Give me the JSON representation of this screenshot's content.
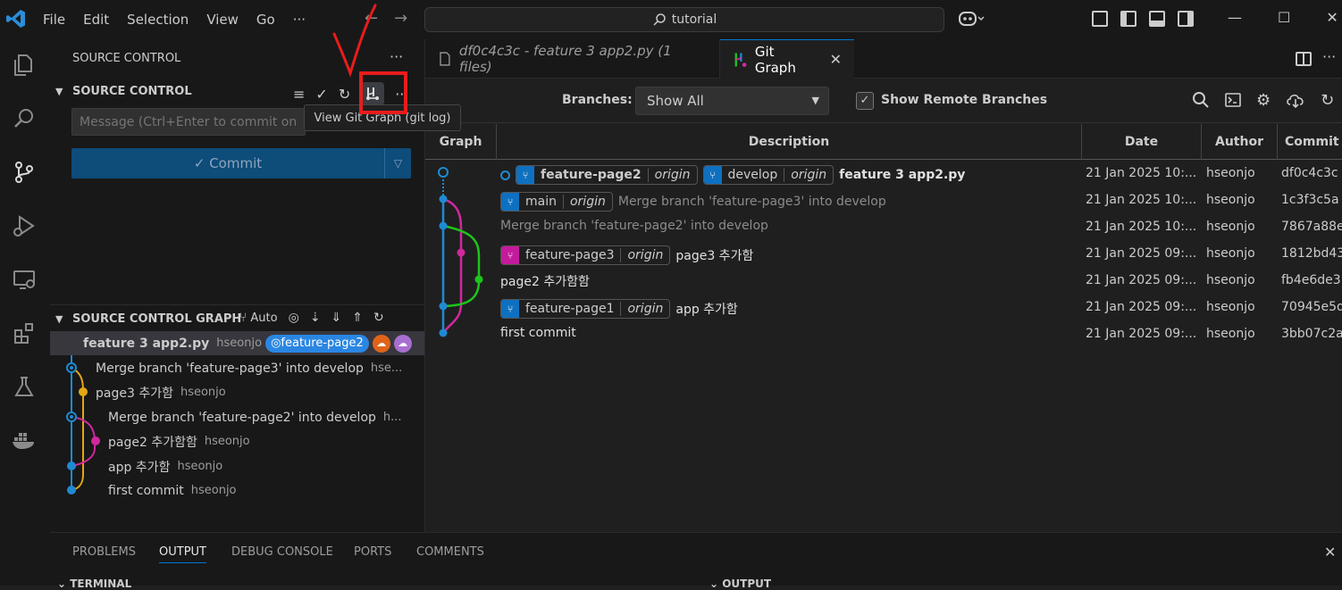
{
  "menu": [
    "File",
    "Edit",
    "Selection",
    "View",
    "Go",
    "···"
  ],
  "nav": {
    "back": "←",
    "forward": "→"
  },
  "search": {
    "text": "tutorial"
  },
  "window": {
    "minimize": "—",
    "maximize": "☐",
    "close": "✕"
  },
  "sidebar": {
    "title": "SOURCE CONTROL",
    "more": "···",
    "section_title": "SOURCE CONTROL",
    "message_placeholder": "Message (Ctrl+Enter to commit on",
    "commit_label": "✓ Commit",
    "tooltip": "View Git Graph (git log)",
    "graph_section_title": "SOURCE CONTROL GRAPH",
    "graph_auto": "Auto",
    "graph_commits": [
      {
        "message": "feature 3 app2.py",
        "author": "hseonjo",
        "badge": "feature-page2"
      },
      {
        "message": "Merge branch 'feature-page3' into develop",
        "author": "hse..."
      },
      {
        "message": "page3 추가함",
        "author": "hseonjo"
      },
      {
        "message": "Merge branch 'feature-page2' into develop",
        "author": "h..."
      },
      {
        "message": "page2 추가함함",
        "author": "hseonjo"
      },
      {
        "message": "app 추가함",
        "author": "hseonjo"
      },
      {
        "message": "first commit",
        "author": "hseonjo"
      }
    ]
  },
  "tabs": [
    {
      "label": "df0c4c3c - feature 3 app2.py (1 files)"
    },
    {
      "label": "Git Graph",
      "close": "✕"
    }
  ],
  "gitgraph": {
    "branches_label": "Branches:",
    "branches_value": "Show All",
    "remote_checked": "✓",
    "remote_label": "Show Remote Branches",
    "columns": [
      "Graph",
      "Description",
      "Date",
      "Author",
      "Commit"
    ],
    "rows": [
      {
        "refs": [
          {
            "name": "feature-page2",
            "color": "#0e70c0",
            "origin": "origin",
            "bold": true
          },
          {
            "name": "develop",
            "color": "#0e70c0",
            "origin": "origin"
          }
        ],
        "message": "feature 3 app2.py",
        "muted": false,
        "bold": true,
        "date": "21 Jan 2025 10:...",
        "author": "hseonjo",
        "hash": "df0c4c3c"
      },
      {
        "refs": [
          {
            "name": "main",
            "color": "#0e70c0",
            "origin": "origin"
          }
        ],
        "message": "Merge branch 'feature-page3' into develop",
        "muted": true,
        "date": "21 Jan 2025 10:...",
        "author": "hseonjo",
        "hash": "1c3f3c5a"
      },
      {
        "refs": [],
        "message": "Merge branch 'feature-page2' into develop",
        "muted": true,
        "date": "21 Jan 2025 10:...",
        "author": "hseonjo",
        "hash": "7867a88e"
      },
      {
        "refs": [
          {
            "name": "feature-page3",
            "color": "#c41a9c",
            "origin": "origin"
          }
        ],
        "message": "page3 추가함",
        "muted": false,
        "date": "21 Jan 2025 09:...",
        "author": "hseonjo",
        "hash": "1812bd43"
      },
      {
        "refs": [],
        "message": "page2 추가함함",
        "muted": false,
        "date": "21 Jan 2025 09:...",
        "author": "hseonjo",
        "hash": "fb4e6de3"
      },
      {
        "refs": [
          {
            "name": "feature-page1",
            "color": "#0e70c0",
            "origin": "origin"
          }
        ],
        "message": "app 추가함",
        "muted": false,
        "date": "21 Jan 2025 09:...",
        "author": "hseonjo",
        "hash": "70945e5d"
      },
      {
        "refs": [],
        "message": "first commit",
        "muted": false,
        "date": "21 Jan 2025 09:...",
        "author": "hseonjo",
        "hash": "3bb07c2a"
      }
    ]
  },
  "panel": {
    "tabs": [
      "PROBLEMS",
      "OUTPUT",
      "DEBUG CONSOLE",
      "PORTS",
      "COMMENTS"
    ],
    "active": "OUTPUT",
    "close": "✕",
    "terminal_label": "TERMINAL",
    "output_label": "OUTPUT"
  },
  "colors": {
    "accent": "#0078d4",
    "blue_lane": "#1f8ad2",
    "magenta_lane": "#d0289e",
    "green_lane": "#1dc41d",
    "red_annotation": "#e81c1c"
  }
}
